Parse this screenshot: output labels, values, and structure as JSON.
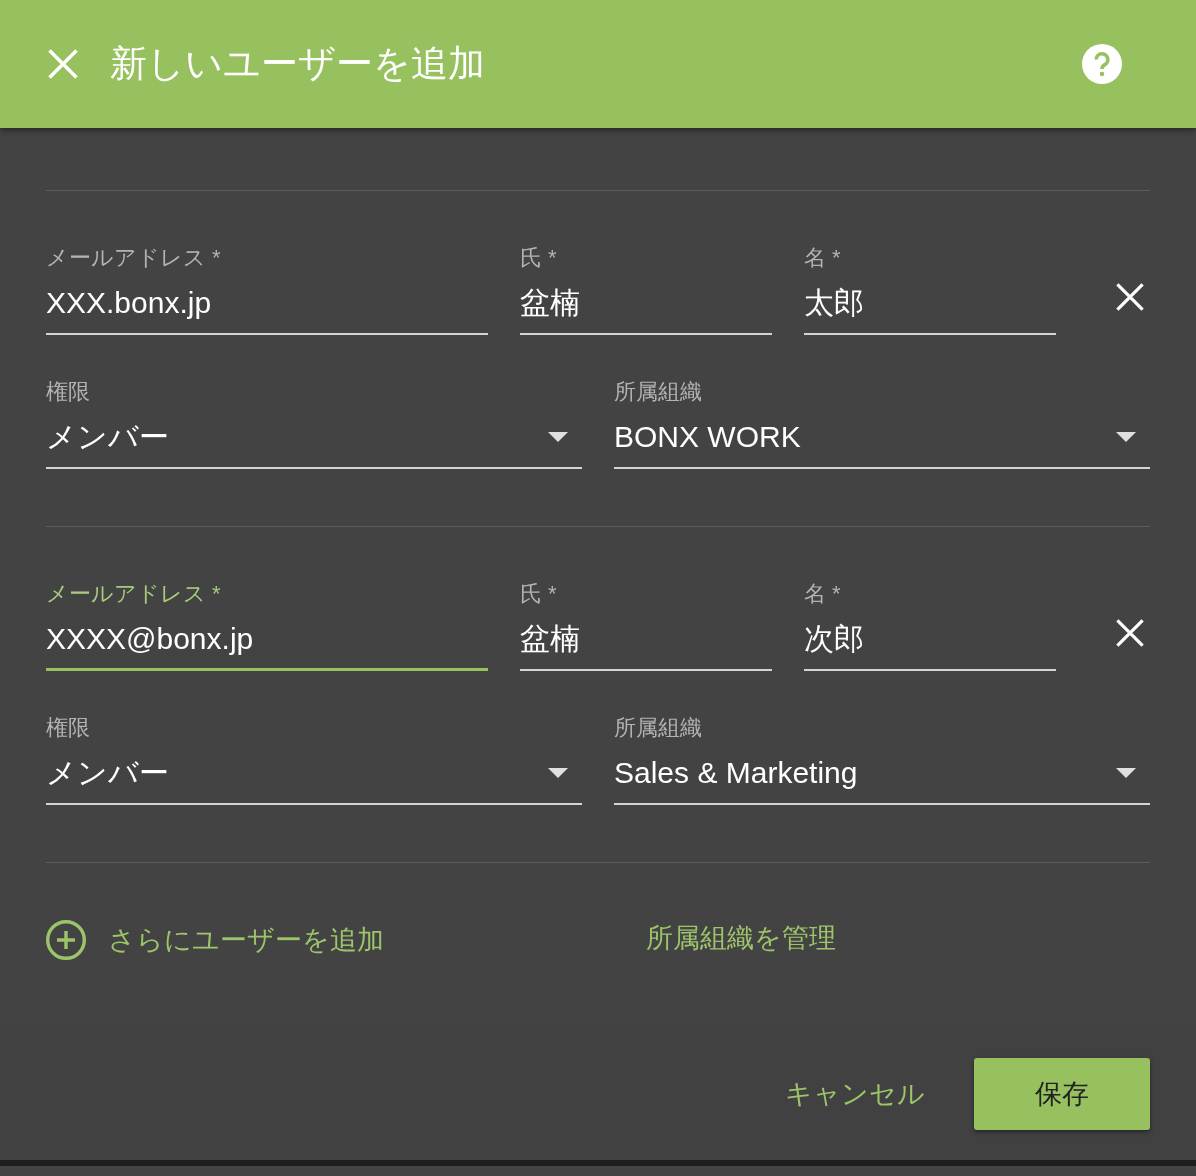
{
  "header": {
    "title": "新しいユーザーを追加"
  },
  "users": [
    {
      "email": {
        "label": "メールアドレス *",
        "value": "XXX.bonx.jp",
        "focused": false
      },
      "family_name": {
        "label": "氏 *",
        "value": "盆楠",
        "focused": false
      },
      "given_name": {
        "label": "名 *",
        "value": "太郎",
        "focused": false
      },
      "role": {
        "label": "権限",
        "value": "メンバー",
        "focused": false
      },
      "organization": {
        "label": "所属組織",
        "value": "BONX WORK",
        "focused": false
      }
    },
    {
      "email": {
        "label": "メールアドレス *",
        "value": "XXXX@bonx.jp",
        "focused": true
      },
      "family_name": {
        "label": "氏 *",
        "value": "盆楠",
        "focused": false
      },
      "given_name": {
        "label": "名 *",
        "value": "次郎",
        "focused": false
      },
      "role": {
        "label": "権限",
        "value": "メンバー",
        "focused": false
      },
      "organization": {
        "label": "所属組織",
        "value": "Sales & Marketing",
        "focused": false
      }
    }
  ],
  "add_user_link": "さらにユーザーを追加",
  "manage_organizations_link": "所属組織を管理",
  "buttons": [
    {
      "label": "キャンセル",
      "kind": "flat"
    },
    {
      "label": "保存",
      "kind": "raised"
    }
  ]
}
